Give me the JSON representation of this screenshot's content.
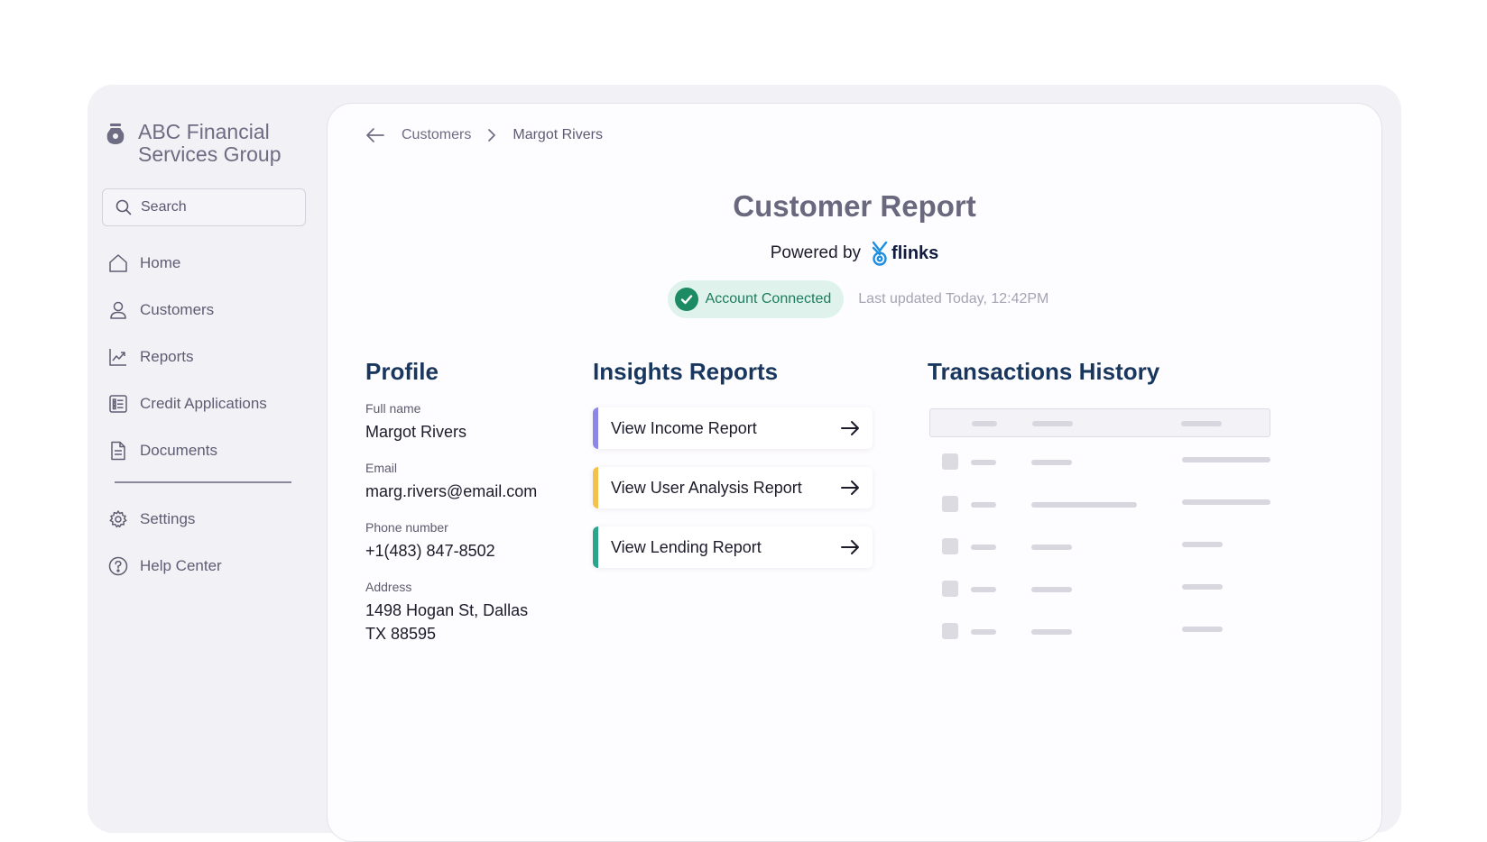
{
  "sidebar": {
    "brand_name": "ABC Financial Services Group",
    "search_placeholder": "Search",
    "items": [
      {
        "label": "Home",
        "icon": "home-icon"
      },
      {
        "label": "Customers",
        "icon": "user-icon"
      },
      {
        "label": "Reports",
        "icon": "chart-icon"
      },
      {
        "label": "Credit Applications",
        "icon": "list-icon"
      },
      {
        "label": "Documents",
        "icon": "document-icon"
      }
    ],
    "bottom_items": [
      {
        "label": "Settings",
        "icon": "gear-icon"
      },
      {
        "label": "Help Center",
        "icon": "help-icon"
      }
    ]
  },
  "breadcrumb": {
    "parent": "Customers",
    "current": "Margot Rivers"
  },
  "header": {
    "title": "Customer Report",
    "powered_by": "Powered by",
    "brand": "flinks",
    "status": "Account Connected",
    "last_updated": "Last updated Today, 12:42PM"
  },
  "profile": {
    "heading": "Profile",
    "fields": [
      {
        "label": "Full name",
        "value": "Margot Rivers"
      },
      {
        "label": "Email",
        "value": "marg.rivers@email.com"
      },
      {
        "label": "Phone number",
        "value": "+1(483) 847-8502"
      },
      {
        "label": "Address",
        "value": "1498 Hogan St, Dallas",
        "value2": "TX 88595"
      }
    ]
  },
  "insights": {
    "heading": "Insights Reports",
    "reports": [
      {
        "label": "View Income Report",
        "accent": "#8b86e8"
      },
      {
        "label": "View User Analysis Report",
        "accent": "#f2c14e"
      },
      {
        "label": "View Lending Report",
        "accent": "#2aa58a"
      }
    ]
  },
  "transactions": {
    "heading": "Transactions History"
  },
  "colors": {
    "heading": "#19375e",
    "status_green": "#1c8b63",
    "flinks_blue": "#1e8fe0"
  }
}
